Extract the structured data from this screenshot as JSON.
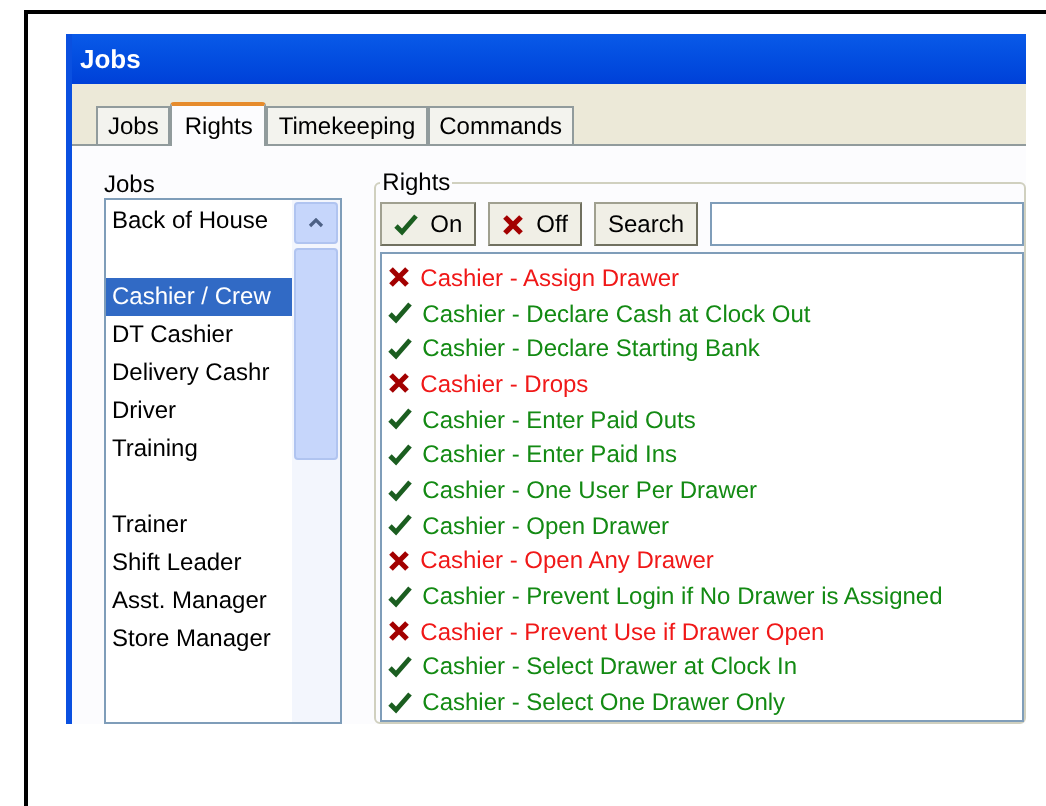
{
  "window": {
    "title": "Jobs"
  },
  "tabs": [
    {
      "label": "Jobs",
      "selected": false
    },
    {
      "label": "Rights",
      "selected": true
    },
    {
      "label": "Timekeeping",
      "selected": false
    },
    {
      "label": "Commands",
      "selected": false
    }
  ],
  "jobs": {
    "label": "Jobs",
    "items": [
      {
        "name": "Back of House",
        "selected": false,
        "gap_before": false
      },
      {
        "name": "Cashier / Crew",
        "selected": true,
        "gap_before": true
      },
      {
        "name": "DT Cashier",
        "selected": false,
        "gap_before": false
      },
      {
        "name": "Delivery Cashr",
        "selected": false,
        "gap_before": false
      },
      {
        "name": "Driver",
        "selected": false,
        "gap_before": false
      },
      {
        "name": "Training",
        "selected": false,
        "gap_before": false
      },
      {
        "name": "Trainer",
        "selected": false,
        "gap_before": true
      },
      {
        "name": "Shift Leader",
        "selected": false,
        "gap_before": false
      },
      {
        "name": "Asst. Manager",
        "selected": false,
        "gap_before": false
      },
      {
        "name": "Store Manager",
        "selected": false,
        "gap_before": false
      }
    ]
  },
  "rights": {
    "label": "Rights",
    "buttons": [
      {
        "label": "On",
        "kind": "on"
      },
      {
        "label": "Off",
        "kind": "off"
      },
      {
        "label": "Search",
        "kind": "plain"
      }
    ],
    "items": [
      {
        "name": "Cashier - Assign Drawer",
        "on": false
      },
      {
        "name": "Cashier - Declare Cash at Clock Out",
        "on": true
      },
      {
        "name": "Cashier - Declare Starting Bank",
        "on": true
      },
      {
        "name": "Cashier - Drops",
        "on": false
      },
      {
        "name": "Cashier - Enter Paid Outs",
        "on": true
      },
      {
        "name": "Cashier - Enter Paid Ins",
        "on": true
      },
      {
        "name": "Cashier - One User Per Drawer",
        "on": true
      },
      {
        "name": "Cashier - Open Drawer",
        "on": true
      },
      {
        "name": "Cashier - Open Any Drawer",
        "on": false
      },
      {
        "name": "Cashier - Prevent Login if No Drawer is Assigned",
        "on": true
      },
      {
        "name": "Cashier - Prevent Use if Drawer Open",
        "on": false
      },
      {
        "name": "Cashier - Select Drawer at Clock In",
        "on": true
      },
      {
        "name": "Cashier - Select One Drawer Only",
        "on": true
      }
    ]
  }
}
